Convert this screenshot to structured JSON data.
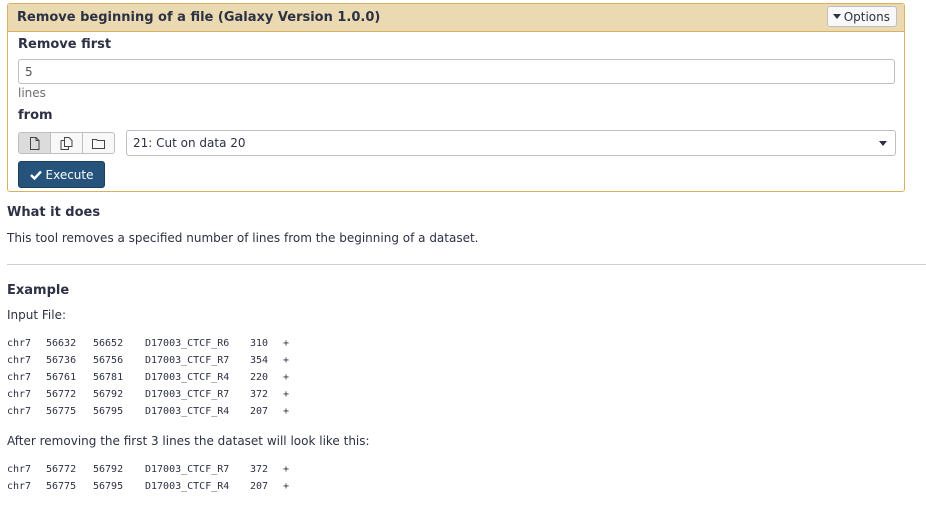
{
  "tool": {
    "title": "Remove beginning of a file (Galaxy Version 1.0.0)",
    "options_label": "Options"
  },
  "form": {
    "remove_first_label": "Remove first",
    "remove_first_value": "5",
    "remove_first_help": "lines",
    "from_label": "from",
    "from_selected": "21: Cut on data 20",
    "execute_label": "Execute"
  },
  "help": {
    "what_it_does_heading": "What it does",
    "description": "This tool removes a specified number of lines from the beginning of a dataset.",
    "example_heading": "Example",
    "input_file_label": "Input File:",
    "input_rows": [
      [
        "chr7",
        "56632",
        "56652",
        "D17003_CTCF_R6",
        "310",
        "+"
      ],
      [
        "chr7",
        "56736",
        "56756",
        "D17003_CTCF_R7",
        "354",
        "+"
      ],
      [
        "chr7",
        "56761",
        "56781",
        "D17003_CTCF_R4",
        "220",
        "+"
      ],
      [
        "chr7",
        "56772",
        "56792",
        "D17003_CTCF_R7",
        "372",
        "+"
      ],
      [
        "chr7",
        "56775",
        "56795",
        "D17003_CTCF_R4",
        "207",
        "+"
      ]
    ],
    "after_label": "After removing the first 3 lines the dataset will look like this:",
    "output_rows": [
      [
        "chr7",
        "56772",
        "56792",
        "D17003_CTCF_R7",
        "372",
        "+"
      ],
      [
        "chr7",
        "56775",
        "56795",
        "D17003_CTCF_R4",
        "207",
        "+"
      ]
    ]
  },
  "icons": {
    "options": "caret-down-icon",
    "single_dataset": "file-icon",
    "multiple_datasets": "files-icon",
    "collection": "folder-icon",
    "execute": "check-icon",
    "select": "caret-down-icon"
  },
  "colors": {
    "panel_border": "#d6b161",
    "panel_header": "#ebd9b2",
    "execute_bg": "#25537b"
  }
}
